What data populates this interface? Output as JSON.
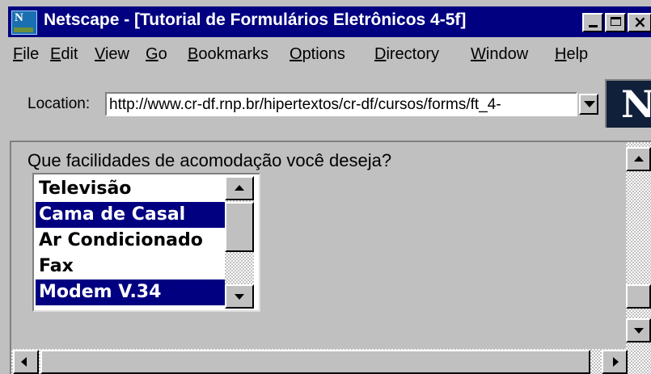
{
  "window": {
    "title": "Netscape - [Tutorial de Formulários Eletrônicos 4-5f]"
  },
  "menu": {
    "items": [
      {
        "label": "File"
      },
      {
        "label": "Edit"
      },
      {
        "label": "View"
      },
      {
        "label": "Go"
      },
      {
        "label": "Bookmarks"
      },
      {
        "label": "Options"
      },
      {
        "label": "Directory"
      },
      {
        "label": "Window"
      },
      {
        "label": "Help"
      }
    ]
  },
  "location": {
    "label": "Location:",
    "url": "http://www.cr-df.rnp.br/hipertextos/cr-df/cursos/forms/ft_4-"
  },
  "logo": {
    "letter": "N"
  },
  "form": {
    "question": "Que facilidades de acomodação você deseja?",
    "options": [
      {
        "label": "Televisão",
        "selected": false
      },
      {
        "label": "Cama de Casal",
        "selected": true
      },
      {
        "label": "Ar Condicionado",
        "selected": false
      },
      {
        "label": "Fax",
        "selected": false
      },
      {
        "label": "Modem V.34",
        "selected": true
      }
    ]
  },
  "colors": {
    "titlebar": "#000080",
    "selection": "#000080",
    "chrome": "#c0c0c0"
  },
  "icons": {
    "app": "netscape-app-icon",
    "minimize": "minimize-icon",
    "maximize": "maximize-icon",
    "close": "close-icon",
    "dropdown": "chevron-down-icon"
  }
}
